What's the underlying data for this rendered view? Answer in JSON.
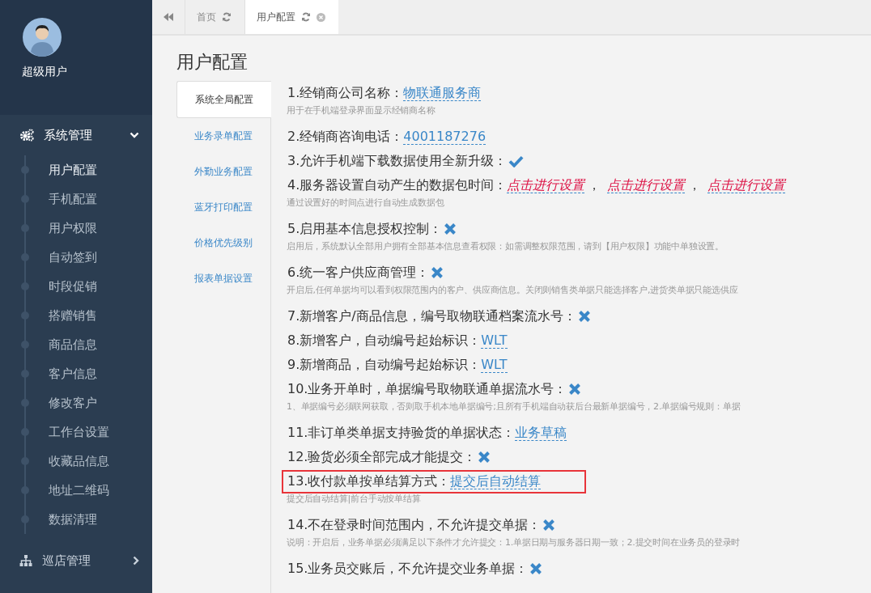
{
  "sidebar": {
    "user_name": "超级用户",
    "menus": [
      {
        "label": "系统管理",
        "expanded": true,
        "children": [
          {
            "label": "用户配置",
            "selected": true
          },
          {
            "label": "手机配置",
            "selected": false
          },
          {
            "label": "用户权限",
            "selected": false
          },
          {
            "label": "自动签到",
            "selected": false
          },
          {
            "label": "时段促销",
            "selected": false
          },
          {
            "label": "搭赠销售",
            "selected": false
          },
          {
            "label": "商品信息",
            "selected": false
          },
          {
            "label": "客户信息",
            "selected": false
          },
          {
            "label": "修改客户",
            "selected": false
          },
          {
            "label": "工作台设置",
            "selected": false
          },
          {
            "label": "收藏品信息",
            "selected": false
          },
          {
            "label": "地址二维码",
            "selected": false
          },
          {
            "label": "数据清理",
            "selected": false
          }
        ]
      },
      {
        "label": "巡店管理",
        "expanded": false
      }
    ]
  },
  "tabs": [
    {
      "label": "首页",
      "selected": false,
      "closable": false
    },
    {
      "label": "用户配置",
      "selected": true,
      "closable": true
    }
  ],
  "page_title": "用户配置",
  "sections": [
    {
      "label": "系统全局配置",
      "selected": true
    },
    {
      "label": "业务录单配置",
      "selected": false
    },
    {
      "label": "外勤业务配置",
      "selected": false
    },
    {
      "label": "蓝牙打印配置",
      "selected": false
    },
    {
      "label": "价格优先级别",
      "selected": false
    },
    {
      "label": "报表单据设置",
      "selected": false
    }
  ],
  "settings": [
    {
      "kind": "link",
      "label": "1.经销商公司名称：",
      "value": "物联通服务商",
      "highlighted": false,
      "note": "用于在手机端登录界面显示经销商名称"
    },
    {
      "kind": "link",
      "label": "2.经销商咨询电话：",
      "value": "4001187276",
      "highlighted": false
    },
    {
      "kind": "toggle",
      "label": "3.允许手机端下载数据使用全新升级：",
      "on": true,
      "highlighted": false
    },
    {
      "kind": "unset-links",
      "label": "4.服务器设置自动产生的数据包时间：",
      "values": [
        "点击进行设置",
        "点击进行设置",
        "点击进行设置"
      ],
      "separator": "，",
      "highlighted": false,
      "note": "通过设置好的时间点进行自动生成数据包"
    },
    {
      "kind": "toggle",
      "label": "5.启用基本信息授权控制：",
      "on": false,
      "highlighted": false,
      "note": "启用后，系统默认全部用户拥有全部基本信息查看权限：如需调整权限范围，请到【用户权限】功能中单独设置。"
    },
    {
      "kind": "toggle",
      "label": "6.统一客户供应商管理：",
      "on": false,
      "highlighted": false,
      "note": "开启后,任何单据均可以看到权限范围内的客户、供应商信息。关闭则销售类单据只能选择客户,进货类单据只能选供应"
    },
    {
      "kind": "toggle",
      "label": "7.新增客户/商品信息，编号取物联通档案流水号：",
      "on": false,
      "highlighted": false
    },
    {
      "kind": "link",
      "label": "8.新增客户，自动编号起始标识：",
      "value": "WLT",
      "highlighted": false
    },
    {
      "kind": "link",
      "label": "9.新增商品，自动编号起始标识：",
      "value": "WLT",
      "highlighted": false
    },
    {
      "kind": "toggle",
      "label": "10.业务开单时，单据编号取物联通单据流水号：",
      "on": false,
      "highlighted": false,
      "note": "1、单据编号必须联网获取，否则取手机本地单据编号;且所有手机端自动获后台最新单据编号，2.单据编号规则：单据"
    },
    {
      "kind": "link",
      "label": "11.非订单类单据支持验货的单据状态：",
      "value": "业务草稿",
      "highlighted": false
    },
    {
      "kind": "toggle",
      "label": "12.验货必须全部完成才能提交：",
      "on": false,
      "highlighted": false
    },
    {
      "kind": "link",
      "label": "13.收付款单按单结算方式：",
      "value": "提交后自动结算",
      "highlighted": true,
      "note": "提交后自动结算|前台手动按单结算"
    },
    {
      "kind": "toggle",
      "label": "14.不在登录时间范围内，不允许提交单据：",
      "on": false,
      "highlighted": false,
      "note": "说明：开启后，业务单据必须满足以下条件才允许提交：1.单据日期与服务器日期一致；2.提交时间在业务员的登录时"
    },
    {
      "kind": "toggle",
      "label": "15.业务员交账后，不允许提交业务单据：",
      "on": false,
      "highlighted": false
    }
  ]
}
